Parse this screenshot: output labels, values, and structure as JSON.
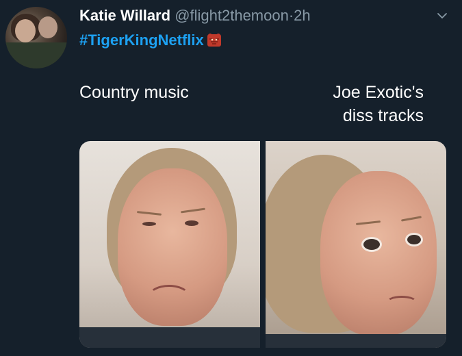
{
  "tweet": {
    "author_name": "Katie Willard",
    "handle": "@flight2themoon",
    "separator": "·",
    "timestamp": "2h",
    "menu_icon": "chevron-down-icon",
    "hashtag": "#TigerKingNetflix",
    "hashtag_emoji_icon": "tiger-face-emoji-icon",
    "caption_left": "Country music",
    "caption_right_line1": "Joe Exotic's",
    "caption_right_line2": "diss tracks"
  },
  "colors": {
    "background": "#15202b",
    "secondary_text": "#8899a6",
    "link": "#1da1f2",
    "primary_text": "#ffffff"
  }
}
